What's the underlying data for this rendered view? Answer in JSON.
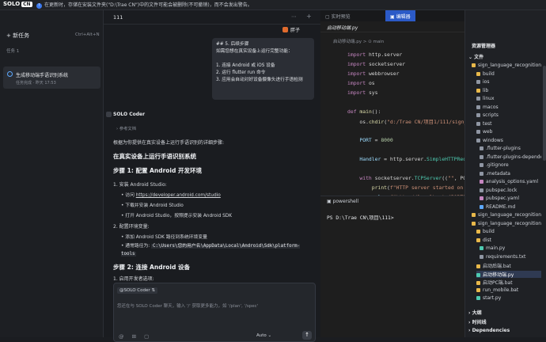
{
  "top": {
    "logo": "SOLO",
    "logo_badge": "CN",
    "warning": "在更新时，存储在安装文件夹(\"D:\\Trae CN\")中的文件可能会被删除(不可撤销)，而不会发出警告。"
  },
  "sidebar": {
    "new_task": "新任务",
    "shortcut": "Ctrl+Alt+N",
    "task_label": "任务 1",
    "task_title": "生成移动端手语识别系统",
    "task_sub": "任务完成 · 昨天 17:53"
  },
  "chat": {
    "title": "111",
    "user_name": "胖子",
    "user_msg": "## 5. 后续步骤\n如需您想在真实设备上运行完整功能：\n\n1. 连接 Android 或 iOS 设备\n2. 运行 flutter run 命令\n3. 应用会自动对好设备摄像头进行手语检测",
    "assistant": "SOLO Coder",
    "ref": "参考文档",
    "intro": "根据为你提供在真实设备上运行手语识别的详细步骤:",
    "h1": "在真实设备上运行手语识别系统",
    "h2": "步骤 1: 配置 Android 开发环境",
    "s1": "1. 安装 Android Studio:",
    "b1_pre": "访问 ",
    "b1_link": "https://developer.android.com/studio",
    "b2": "下载并安装 Android Studio",
    "b3": "打开 Android Studio，按照提示安装 Android SDK",
    "s2": "2. 配置环境变量:",
    "b4": "添加 Android SDK 路径到系统环境变量",
    "b5_pre": "通常路径为: ",
    "b5_code": "C:\\Users\\您的用户名\\AppData\\Local\\Android\\Sdk\\platform-tools",
    "h3": "步骤 2: 连接 Android 设备",
    "s3": "1. 启用开发者选项:",
    "mention": "@SOLO Coder ⇅",
    "placeholder": "您还在与 SOLO Coder 聊天，输入 '/' 获取更多能力，如 '/plan', '/spec'",
    "auto": "Auto ⌄"
  },
  "editor": {
    "tab1": "实时预览",
    "tab2": "编辑器",
    "file": "启动移动端.py",
    "breadcrumb": "启动移动端.py > ⊙ main",
    "terminal_tab": "powershell",
    "terminal_line": "PS D:\\Trae CN\\项目\\111>"
  },
  "explorer": {
    "title": "资源管理器",
    "section_files": "文件",
    "items": [
      "sign_language_recognition_app",
      "build",
      "ios",
      "lib",
      "linux",
      "macos",
      "scripts",
      "test",
      "web",
      "windows",
      ".flutter-plugins",
      ".flutter-plugins-dependencies",
      ".gitignore",
      ".metadata",
      "analysis_options.yaml",
      "pubspec.lock",
      "pubspec.yaml",
      "README.md",
      "sign_language_recognition_app",
      "sign_language_recognition_backend",
      "build",
      "dist",
      "main.py",
      "requirements.txt",
      "启动后端.bat",
      "启动移动端.py",
      "启动PC端.bat",
      "run_mobile.bat",
      "start.py"
    ],
    "section_outline": "大纲",
    "section_timeline": "时间线",
    "section_deps": "Dependencies"
  }
}
